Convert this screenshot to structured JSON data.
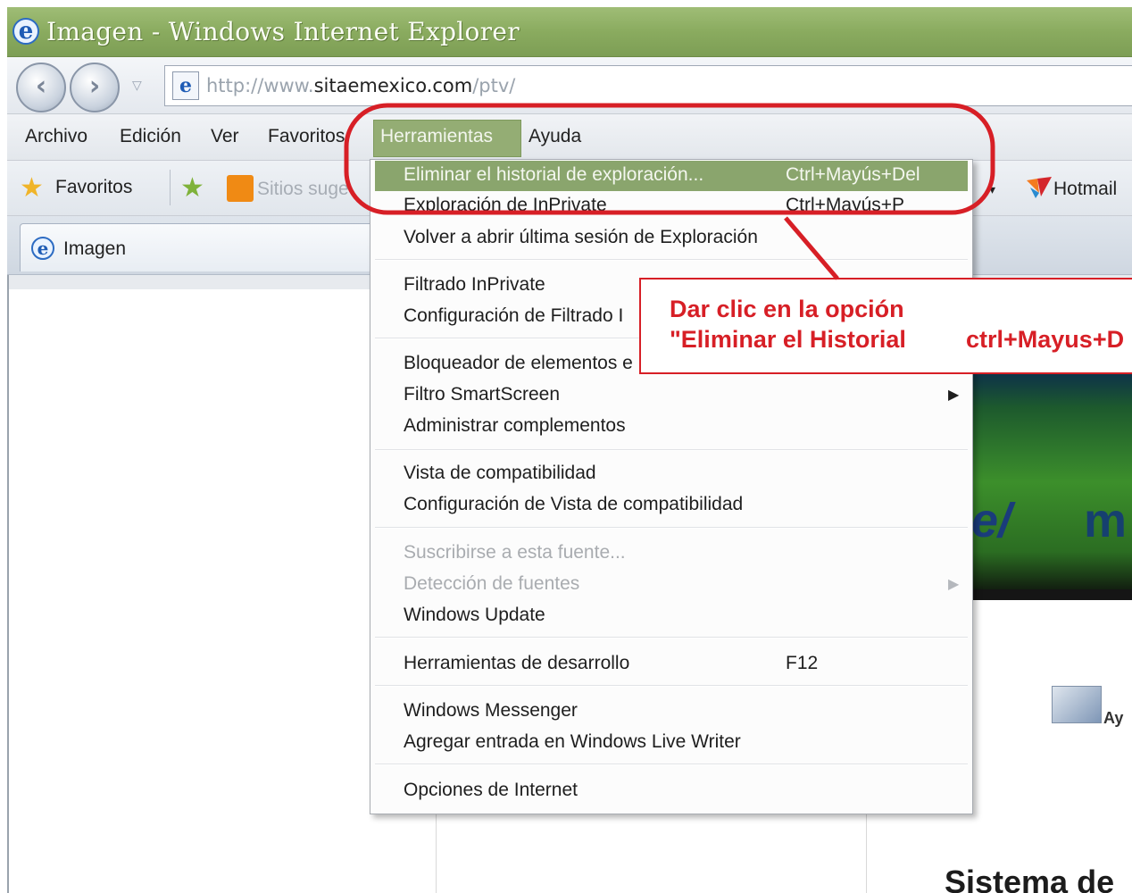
{
  "window": {
    "title": "Imagen - Windows Internet Explorer",
    "icon": "ie-icon"
  },
  "navigation": {
    "back_icon": "back-arrow-icon",
    "forward_icon": "forward-arrow-icon",
    "dropdown_icon": "chevron-down-icon",
    "url_prefix": "http://www.",
    "url_domain": "sitaemexico.com",
    "url_suffix": "/ptv/"
  },
  "menubar": {
    "items": [
      {
        "label": "Archivo"
      },
      {
        "label": "Edición"
      },
      {
        "label": "Ver"
      },
      {
        "label": "Favoritos"
      },
      {
        "label": "Herramientas",
        "active": true
      },
      {
        "label": "Ayuda"
      }
    ]
  },
  "favbar": {
    "favorites_label": "Favoritos",
    "suggested_label": "Sitios suge",
    "hotmail_label": "Hotmail"
  },
  "tab": {
    "label": "Imagen"
  },
  "tools_menu": {
    "items": [
      {
        "label": "Eliminar el historial de exploración...",
        "shortcut": "Ctrl+Mayús+Del",
        "highlighted": true
      },
      {
        "label": "Exploración de InPrivate",
        "shortcut": "Ctrl+Mayús+P"
      },
      {
        "label": "Volver a abrir última sesión de Exploración"
      },
      {
        "label": "Filtrado InPrivate"
      },
      {
        "label": "Configuración de Filtrado I"
      },
      {
        "label": "Bloqueador de elementos e"
      },
      {
        "label": "Filtro SmartScreen",
        "submenu": true
      },
      {
        "label": "Administrar complementos"
      },
      {
        "label": "Vista de compatibilidad"
      },
      {
        "label": "Configuración de Vista de compatibilidad"
      },
      {
        "label": "Suscribirse a esta fuente...",
        "disabled": true
      },
      {
        "label": "Detección de fuentes",
        "disabled": true,
        "submenu": true
      },
      {
        "label": "Windows Update"
      },
      {
        "label": "Herramientas de desarrollo",
        "shortcut": "F12"
      },
      {
        "label": "Windows Messenger"
      },
      {
        "label": "Agregar entrada en Windows Live Writer"
      },
      {
        "label": "Opciones de Internet"
      }
    ]
  },
  "callout": {
    "line1": "Dar clic en la opción",
    "line2": "\"Eliminar el Historial",
    "line3": "ctrl+Mayus+D"
  },
  "page": {
    "aux_label": "Ay",
    "heading": "Sistema de",
    "banner_text_1": "e/",
    "banner_text_2": "m"
  },
  "colors": {
    "annotation_red": "#d71f26",
    "menu_highlight": "#8aa56d",
    "titlebar_green": "#8aab5f"
  }
}
